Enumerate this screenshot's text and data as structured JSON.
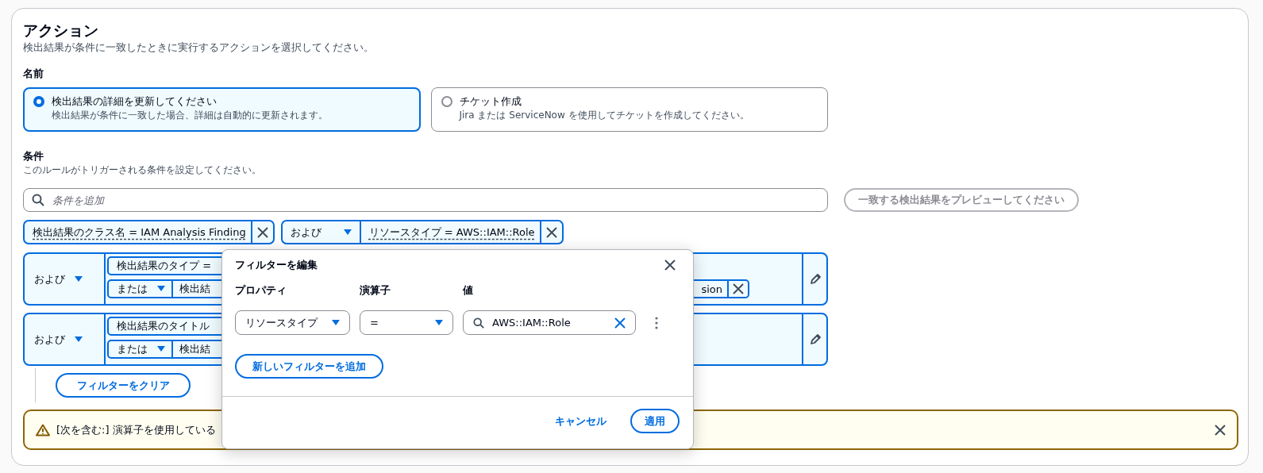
{
  "section": {
    "title": "アクション",
    "description": "検出結果が条件に一致したときに実行するアクションを選択してください。"
  },
  "name_label": "名前",
  "actions": [
    {
      "title": "検出結果の詳細を更新してください",
      "description": "検出結果が条件に一致した場合、詳細は自動的に更新されます。",
      "selected": true
    },
    {
      "title": "チケット作成",
      "description": "Jira または ServiceNow を使用してチケットを作成してください。",
      "selected": false
    }
  ],
  "conditions": {
    "label": "条件",
    "description": "このルールがトリガーされる条件を設定してください。",
    "search": {
      "placeholder": "条件を追加"
    },
    "preview_button": {
      "label": "一致する検出結果をプレビューしてください",
      "disabled": true
    }
  },
  "tokens": [
    {
      "text": "検出結果のクラス名 = IAM Analysis Finding"
    },
    {
      "operator": "および",
      "text": "リソースタイプ = AWS::IAM::Role"
    }
  ],
  "groups": [
    {
      "operator": "および",
      "rows": [
        {
          "chip": "検出結果のタイプ ="
        },
        {
          "operator": "または",
          "chip": "検出結",
          "end_chip": "sion"
        }
      ]
    },
    {
      "operator": "および",
      "rows": [
        {
          "chip": "検出結果のタイトル"
        },
        {
          "operator": "または",
          "chip": "検出結"
        }
      ]
    }
  ],
  "clear_button": "フィルターをクリア",
  "warning": {
    "text": "[次を含む:] 演算子を使用している"
  },
  "popover": {
    "title": "フィルターを編集",
    "columns": [
      "プロパティ",
      "演算子",
      "値"
    ],
    "property": "リソースタイプ",
    "operator": "=",
    "value": "AWS::IAM::Role",
    "add_button": "新しいフィルターを追加",
    "cancel": "キャンセル",
    "apply": "適用"
  }
}
